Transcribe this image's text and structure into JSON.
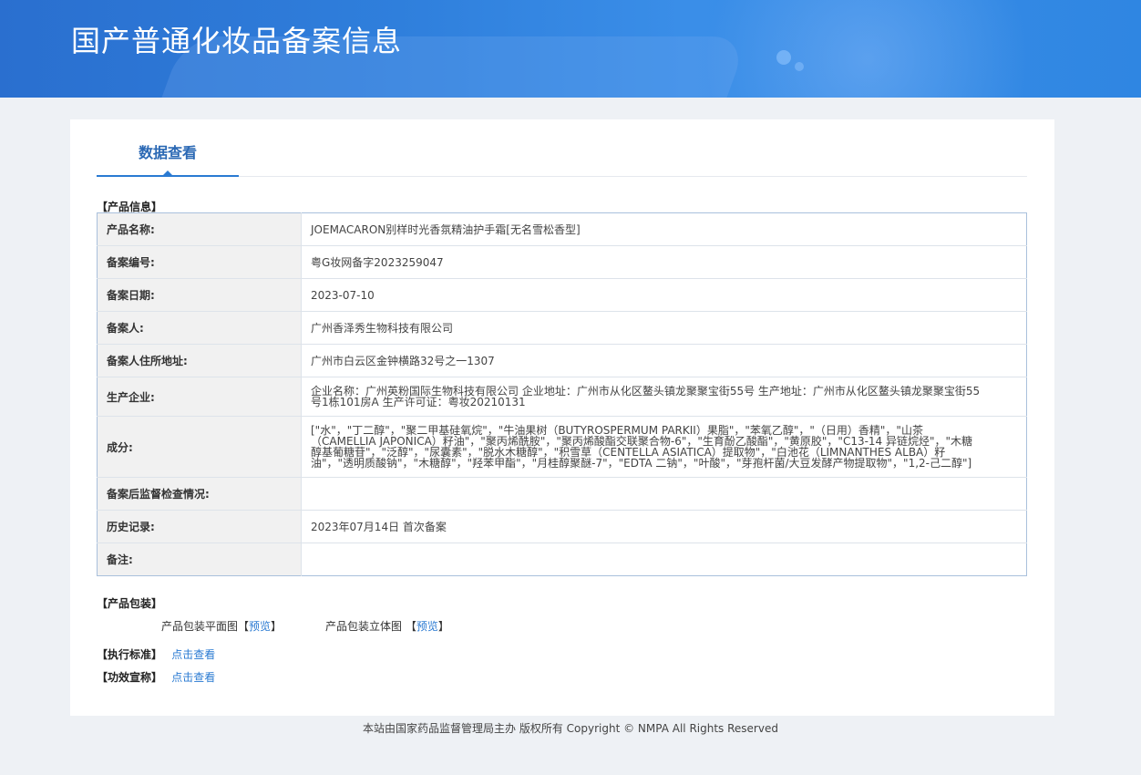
{
  "header": {
    "title": "国产普通化妆品备案信息"
  },
  "tabs": [
    {
      "label": "数据查看"
    }
  ],
  "product_info": {
    "section_label": "【产品信息】",
    "rows": [
      {
        "key": "产品名称:",
        "value": "JOEMACARON别样时光香氛精油护手霜[无名雪松香型]"
      },
      {
        "key": "备案编号:",
        "value": "粤G妆网备字2023259047"
      },
      {
        "key": "备案日期:",
        "value": "2023-07-10"
      },
      {
        "key": "备案人:",
        "value": "广州香泽秀生物科技有限公司"
      },
      {
        "key": "备案人住所地址:",
        "value": "广州市白云区金钟横路32号之一1307"
      },
      {
        "key": "生产企业:",
        "value": "企业名称：广州英粉国际生物科技有限公司 企业地址：广州市从化区鳌头镇龙聚聚宝街55号 生产地址：广州市从化区鳌头镇龙聚聚宝街55号1栋101房A 生产许可证：粤妆20210131"
      },
      {
        "key": "成分:",
        "value": "[\"水\"，\"丁二醇\"，\"聚二甲基硅氧烷\"，\"牛油果树（BUTYROSPERMUM PARKII）果脂\"，\"苯氧乙醇\"，\"（日用）香精\"，\"山茶（CAMELLIA JAPONICA）籽油\"，\"聚丙烯酰胺\"，\"聚丙烯酸酯交联聚合物-6\"，\"生育酚乙酸酯\"，\"黄原胶\"，\"C13-14 异链烷烃\"，\"木糖醇基葡糖苷\"，\"泛醇\"，\"尿囊素\"，\"脱水木糖醇\"，\"积雪草（CENTELLA ASIATICA）提取物\"，\"白池花（LIMNANTHES ALBA）籽油\"，\"透明质酸钠\"，\"木糖醇\"，\"羟苯甲酯\"，\"月桂醇聚醚-7\"，\"EDTA 二钠\"，\"叶酸\"，\"芽孢杆菌/大豆发酵产物提取物\"，\"1,2-己二醇\"]"
      },
      {
        "key": "备案后监督检查情况:",
        "value": ""
      },
      {
        "key": "历史记录:",
        "value": "2023年07月14日 首次备案"
      },
      {
        "key": "备注:",
        "value": ""
      }
    ]
  },
  "packaging": {
    "section_label": "【产品包装】",
    "flat_label": "产品包装平面图",
    "flat_link": "预览",
    "cube_label": "产品包装立体图",
    "cube_link": "预览"
  },
  "standard": {
    "section_label": "【执行标准】",
    "link": "点击查看"
  },
  "efficacy": {
    "section_label": "【功效宣称】",
    "link": "点击查看"
  },
  "footer": {
    "text": "本站由国家药品监督管理局主办 版权所有 Copyright © NMPA All Rights Reserved"
  }
}
